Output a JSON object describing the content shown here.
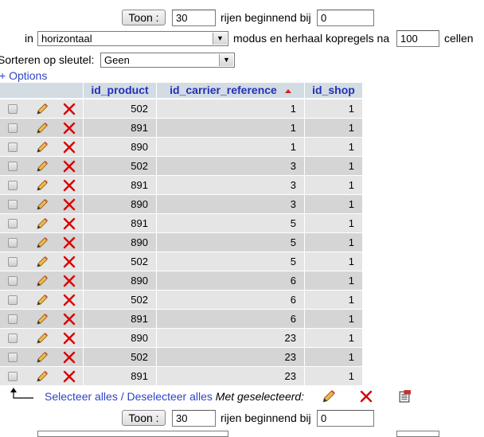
{
  "top_nav": {
    "show_button": "Toon :",
    "rows_value": "30",
    "rows_label": "rijen beginnend bij",
    "start_value": "0",
    "in_label": "in",
    "mode_value": "horizontaal",
    "mode_label": "modus en herhaal kopregels na",
    "repeat_value": "100",
    "cells_label": "cellen"
  },
  "sort": {
    "label": "Sorteren op sleutel:",
    "value": "Geen"
  },
  "options_link": "+ Options",
  "table": {
    "headers": [
      "id_product",
      "id_carrier_reference",
      "id_shop"
    ],
    "sorted_column": "id_carrier_reference",
    "rows": [
      [
        "502",
        "1",
        "1"
      ],
      [
        "891",
        "1",
        "1"
      ],
      [
        "890",
        "1",
        "1"
      ],
      [
        "502",
        "3",
        "1"
      ],
      [
        "891",
        "3",
        "1"
      ],
      [
        "890",
        "3",
        "1"
      ],
      [
        "891",
        "5",
        "1"
      ],
      [
        "890",
        "5",
        "1"
      ],
      [
        "502",
        "5",
        "1"
      ],
      [
        "890",
        "6",
        "1"
      ],
      [
        "502",
        "6",
        "1"
      ],
      [
        "891",
        "6",
        "1"
      ],
      [
        "890",
        "23",
        "1"
      ],
      [
        "502",
        "23",
        "1"
      ],
      [
        "891",
        "23",
        "1"
      ]
    ]
  },
  "bulk": {
    "select_all": "Selecteer alles",
    "separator": "/",
    "deselect_all": "Deselecteer alles",
    "with_selected": "Met geselecteerd:"
  },
  "bottom_nav": {
    "show_button": "Toon :",
    "rows_value": "30",
    "rows_label": "rijen beginnend bij",
    "start_value": "0"
  },
  "colors": {
    "header_bg": "#d3dce3",
    "row_odd": "#e5e5e5",
    "row_even": "#d5d5d5",
    "link": "#2f43c7",
    "delete_red": "#d80000"
  },
  "icons": {
    "edit": "pencil-icon",
    "delete": "delete-x-icon",
    "export": "export-icon",
    "select_arrow": "corner-arrow-icon"
  }
}
